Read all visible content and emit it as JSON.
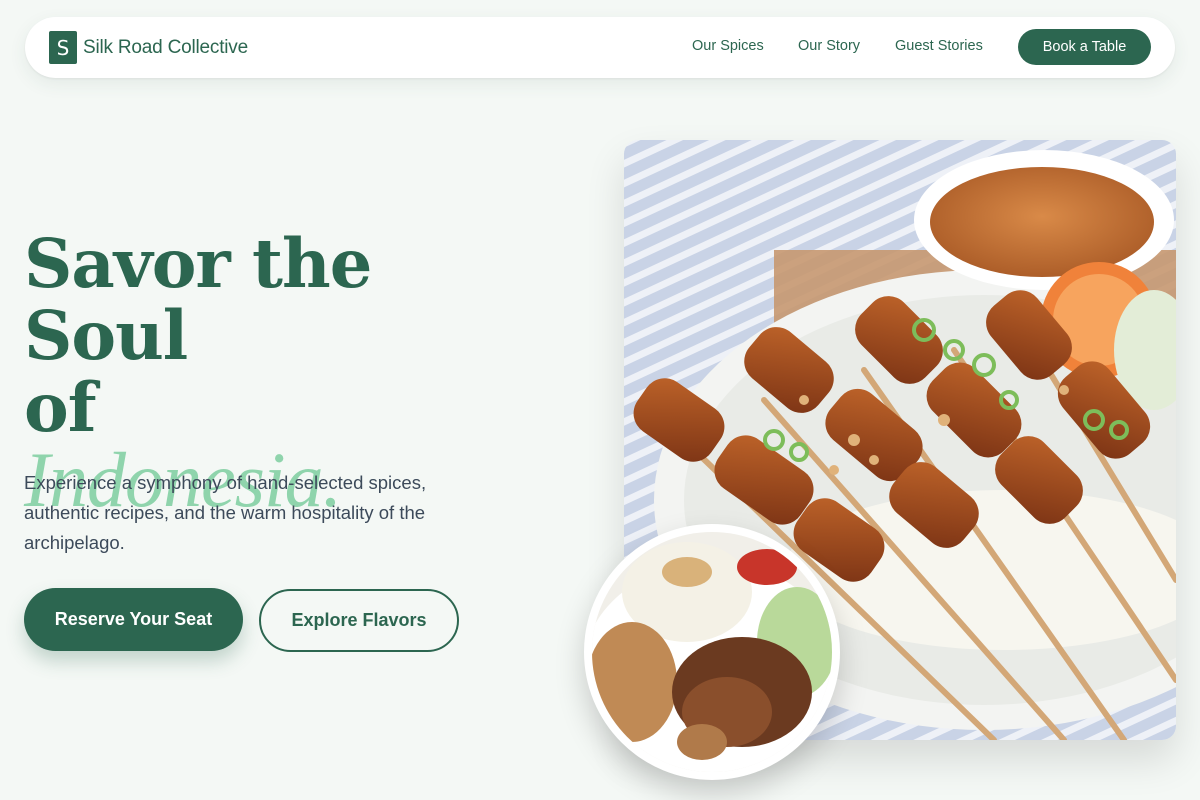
{
  "brand": {
    "mark": "S",
    "name": "Silk Road Collective"
  },
  "nav": {
    "links": [
      "Our Spices",
      "Our Story",
      "Guest Stories"
    ],
    "cta": "Book a Table"
  },
  "hero": {
    "headline_line1": "Savor the Soul",
    "headline_line2": "of",
    "headline_accent": "Indonesia.",
    "lede": "Experience a symphony of hand-selected spices, authentic recipes, and the warm hospitality of the archipelago.",
    "primary_button": "Reserve Your Seat",
    "secondary_button": "Explore Flavors"
  },
  "images": {
    "main": "satay-skewers-photo",
    "inset": "nasi-plate-photo"
  },
  "colors": {
    "brand_green": "#2c6650",
    "accent_mint": "#8fd4ac",
    "background": "#f4f8f5",
    "body_text": "#3c4a5a"
  }
}
